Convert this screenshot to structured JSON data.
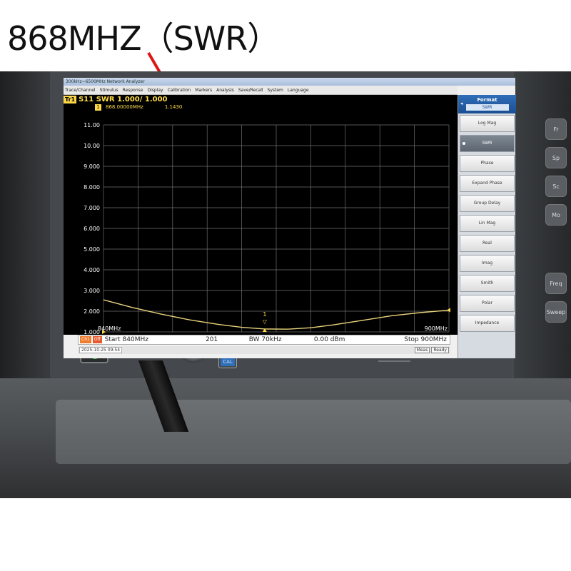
{
  "caption": {
    "text": "868MHZ（SWR）"
  },
  "window": {
    "title": "300kHz~6500MHz Network Analyzer"
  },
  "menu": [
    {
      "label": "Trace/Channel"
    },
    {
      "label": "Stimulus"
    },
    {
      "label": "Response"
    },
    {
      "label": "Display"
    },
    {
      "label": "Calibration"
    },
    {
      "label": "Markers"
    },
    {
      "label": "Analysis"
    },
    {
      "label": "Save/Recall"
    },
    {
      "label": "System"
    },
    {
      "label": "Language"
    }
  ],
  "trace": {
    "tag": "Tr1",
    "label": "S11 SWR 1.000/ 1.000"
  },
  "marker": {
    "number": "1",
    "frequency": "868.00000MHz",
    "value": "1.1430",
    "plot_label": "1",
    "plot_symbol": "▽"
  },
  "colors": {
    "trace": "#e8d27a",
    "grid": "#6f6f6f",
    "label": "#ffdc4a",
    "screen_bg": "#000000"
  },
  "chart_data": {
    "type": "line",
    "title": "S11 SWR 1.000/ 1.000",
    "xlabel": "",
    "ylabel": "",
    "x_start_label": "840MHz",
    "x_stop_label": "900MHz",
    "xlim": [
      840,
      900
    ],
    "ylim": [
      1.0,
      11.0
    ],
    "y_ticks": [
      "11.00",
      "10.00",
      "9.000",
      "8.000",
      "7.000",
      "6.000",
      "5.000",
      "4.000",
      "3.000",
      "2.000",
      "1.000"
    ],
    "grid": true,
    "series": [
      {
        "x": [
          840,
          845,
          850,
          855,
          860,
          864,
          868,
          872,
          876,
          880,
          885,
          890,
          895,
          900
        ],
        "y": [
          2.55,
          2.18,
          1.86,
          1.58,
          1.36,
          1.22,
          1.143,
          1.13,
          1.2,
          1.34,
          1.56,
          1.78,
          1.93,
          2.05
        ]
      }
    ]
  },
  "status": {
    "channel_tag": "Ch1",
    "off_tag": "Off",
    "start": "Start 840MHz",
    "points": "201",
    "bandwidth": "BW 70kHz",
    "power": "0.00 dBm",
    "stop": "Stop 900MHz",
    "timestamp": "2025-10-25 09:54",
    "meas": "Meas",
    "ready": "Ready"
  },
  "softkeys": {
    "title": "Format",
    "current": "SWR",
    "back": "◂",
    "items": [
      {
        "label": "Log Mag",
        "active": false
      },
      {
        "label": "SWR",
        "active": true
      },
      {
        "label": "Phase",
        "active": false
      },
      {
        "label": "Expand Phase",
        "active": false
      },
      {
        "label": "Group Delay",
        "active": false
      },
      {
        "label": "Lin Mag",
        "active": false
      },
      {
        "label": "Real",
        "active": false
      },
      {
        "label": "Imag",
        "active": false
      },
      {
        "label": "Smith",
        "active": false
      },
      {
        "label": "Polar",
        "active": false
      },
      {
        "label": "Impedance",
        "active": false
      }
    ]
  },
  "hardware": {
    "port_number": "1",
    "port_badge": "CAL",
    "side_keys": [
      "Fr",
      "Sp",
      "Sc",
      "Mo",
      "Freq",
      "Sweep"
    ]
  }
}
